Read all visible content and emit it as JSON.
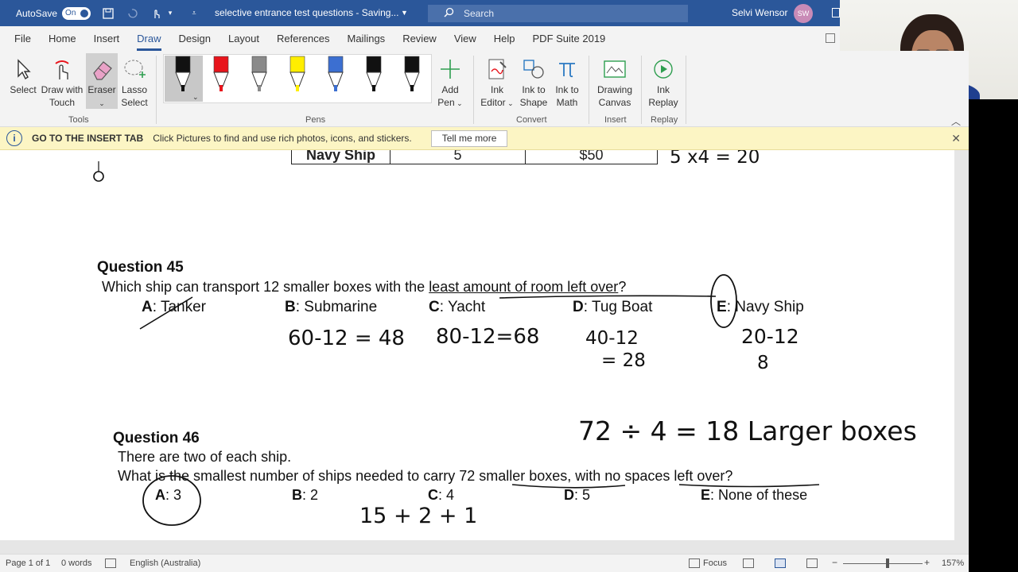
{
  "titlebar": {
    "autosave_label": "AutoSave",
    "autosave_state": "On",
    "doc_title": "selective entrance test questions  -  Saving...",
    "search_placeholder": "Search",
    "user_name": "Selvi Wensor",
    "user_initials": "SW"
  },
  "menu": {
    "tabs": [
      "File",
      "Home",
      "Insert",
      "Draw",
      "Design",
      "Layout",
      "References",
      "Mailings",
      "Review",
      "View",
      "Help",
      "PDF Suite 2019"
    ],
    "active": "Draw"
  },
  "ribbon": {
    "tools": {
      "select": "Select",
      "draw_touch_1": "Draw with",
      "draw_touch_2": "Touch",
      "eraser": "Eraser",
      "lasso_1": "Lasso",
      "lasso_2": "Select",
      "group": "Tools"
    },
    "pens_group": "Pens",
    "add_pen_1": "Add",
    "add_pen_2": "Pen",
    "convert": {
      "ink_editor_1": "Ink",
      "ink_editor_2": "Editor",
      "ink_shape_1": "Ink to",
      "ink_shape_2": "Shape",
      "ink_math_1": "Ink to",
      "ink_math_2": "Math",
      "group": "Convert"
    },
    "insert": {
      "canvas_1": "Drawing",
      "canvas_2": "Canvas",
      "group": "Insert"
    },
    "replay": {
      "label_1": "Ink",
      "label_2": "Replay",
      "group": "Replay"
    },
    "pen_colors": [
      "#111111",
      "#e8141c",
      "#8a8a8a",
      "#ffee00",
      "#3c6fd1",
      "#111111",
      "#111111"
    ]
  },
  "infobar": {
    "title": "GO TO THE INSERT TAB",
    "text": "Click Pictures to find and use rich photos, icons, and stickers.",
    "button": "Tell me more"
  },
  "document": {
    "table_row": {
      "name": "Navy Ship",
      "qty": "5",
      "price": "$50"
    },
    "q45": {
      "title": "Question 45",
      "text_prefix": "Which ship can transport 12 smaller boxes with the ",
      "text_underlined": "least amount of room left over",
      "text_suffix": "?",
      "options": [
        {
          "letter": "A",
          "text": ": Tanker"
        },
        {
          "letter": "B",
          "text": ":  Submarine"
        },
        {
          "letter": "C",
          "text": ": Yacht"
        },
        {
          "letter": "D",
          "text": ": Tug Boat"
        },
        {
          "letter": "E",
          "text": ": Navy Ship"
        }
      ]
    },
    "q46": {
      "title": "Question 46",
      "line1": "There are two of each ship.",
      "line2_a": "What is the smallest number of ships needed to carry ",
      "line2_u1": "72 smaller boxes",
      "line2_b": ", with ",
      "line2_u2": "no spaces left over",
      "line2_c": "?",
      "options": [
        {
          "letter": "A",
          "text": ": 3"
        },
        {
          "letter": "B",
          "text": ":  2"
        },
        {
          "letter": "C",
          "text": ": 4"
        },
        {
          "letter": "D",
          "text": ": 5"
        },
        {
          "letter": "E",
          "text": ": None of these"
        }
      ]
    },
    "handwriting": {
      "top_calc": "5 x4 = 20",
      "b_calc": "60-12 = 48",
      "c_calc": "80-12=68",
      "d_calc_1": "40-12",
      "d_calc_2": "= 28",
      "e_calc_1": "20-12",
      "e_calc_2": "8",
      "large_boxes": "72 ÷ 4 = 18 Larger boxes",
      "sum": "15 + 2 + 1"
    }
  },
  "status": {
    "page": "Page 1 of 1",
    "words": "0 words",
    "language": "English (Australia)",
    "focus": "Focus",
    "zoom": "157%"
  }
}
